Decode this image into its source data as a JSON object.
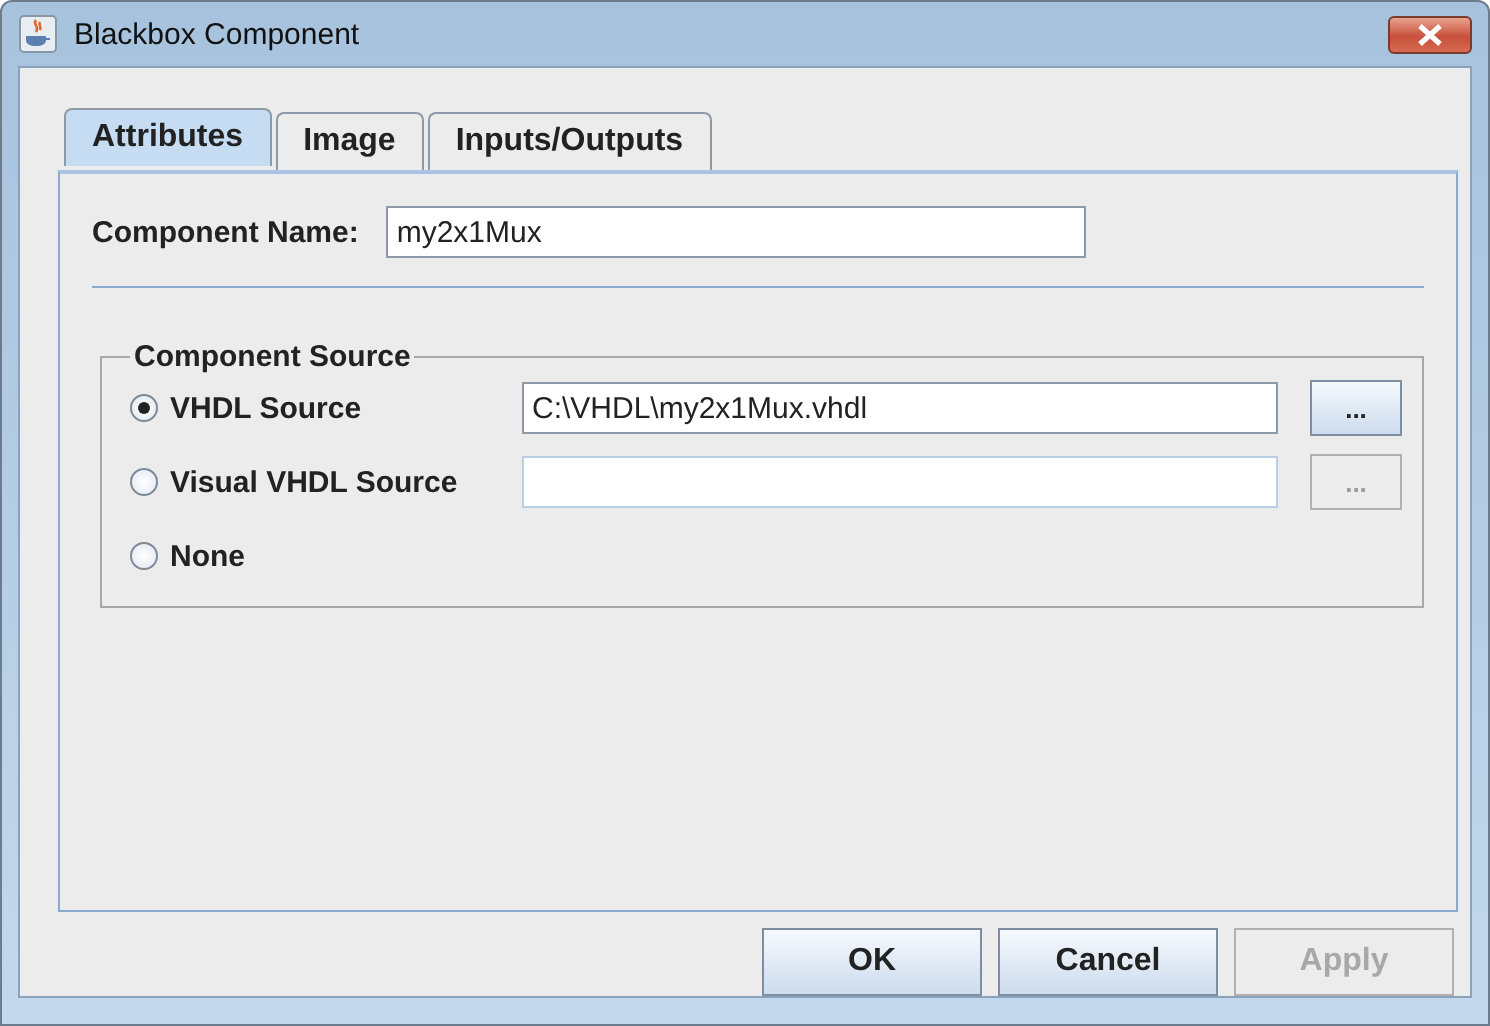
{
  "window": {
    "title": "Blackbox Component"
  },
  "tabs": [
    {
      "label": "Attributes",
      "selected": true
    },
    {
      "label": "Image",
      "selected": false
    },
    {
      "label": "Inputs/Outputs",
      "selected": false
    }
  ],
  "name_field": {
    "label": "Component Name:",
    "value": "my2x1Mux"
  },
  "source_group": {
    "title": "Component Source",
    "options": [
      {
        "label": "VHDL Source",
        "selected": true,
        "field": {
          "value": "C:\\VHDL\\my2x1Mux.vhdl",
          "disabled": false
        },
        "browse": {
          "label": "...",
          "disabled": false
        }
      },
      {
        "label": "Visual VHDL Source",
        "selected": false,
        "field": {
          "disabled": true
        },
        "browse": {
          "label": "...",
          "disabled": true
        }
      },
      {
        "label": "None",
        "selected": false
      }
    ]
  },
  "buttons": [
    {
      "label": "OK",
      "disabled": false
    },
    {
      "label": "Cancel",
      "disabled": false
    },
    {
      "label": "Apply",
      "disabled": true
    }
  ]
}
